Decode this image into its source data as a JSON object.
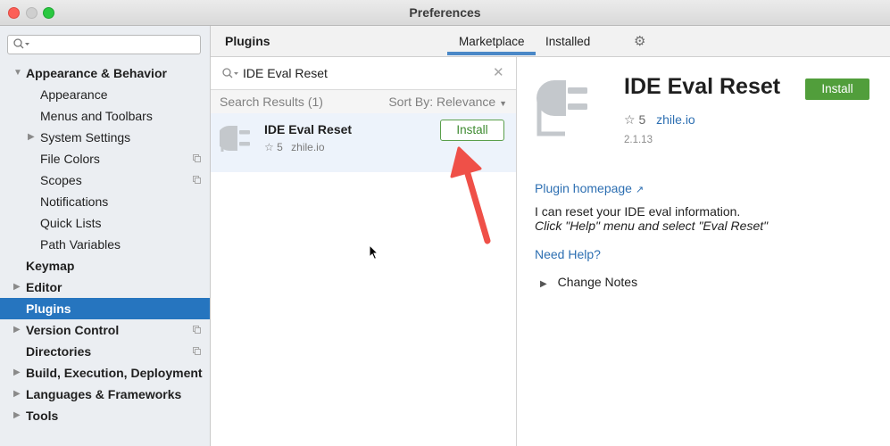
{
  "window": {
    "title": "Preferences"
  },
  "sidebar": {
    "search_placeholder": "",
    "items": [
      {
        "label": "Appearance & Behavior",
        "expanded": true,
        "bold": true
      },
      {
        "label": "Appearance"
      },
      {
        "label": "Menus and Toolbars"
      },
      {
        "label": "System Settings",
        "collapsed": true
      },
      {
        "label": "File Colors",
        "project": true
      },
      {
        "label": "Scopes",
        "project": true
      },
      {
        "label": "Notifications"
      },
      {
        "label": "Quick Lists"
      },
      {
        "label": "Path Variables"
      },
      {
        "label": "Keymap",
        "bold": true
      },
      {
        "label": "Editor",
        "bold": true
      },
      {
        "label": "Plugins",
        "bold": true,
        "selected": true
      },
      {
        "label": "Version Control",
        "bold": true,
        "project": true
      },
      {
        "label": "Directories",
        "bold": true,
        "project": true
      },
      {
        "label": "Build, Execution, Deployment",
        "bold": true
      },
      {
        "label": "Languages & Frameworks",
        "bold": true
      },
      {
        "label": "Tools",
        "bold": true
      }
    ]
  },
  "plugins": {
    "title": "Plugins",
    "tabs": [
      {
        "label": "Marketplace",
        "active": true
      },
      {
        "label": "Installed"
      }
    ],
    "search": {
      "value": "IDE Eval Reset"
    },
    "results_label": "Search Results (1)",
    "sort_label": "Sort By: Relevance",
    "results": [
      {
        "name": "IDE Eval Reset",
        "rating": "5",
        "vendor": "zhile.io",
        "install_label": "Install"
      }
    ]
  },
  "detail": {
    "name": "IDE Eval Reset",
    "install_label": "Install",
    "rating": "5",
    "vendor": "zhile.io",
    "version": "2.1.13",
    "homepage_label": "Plugin homepage",
    "desc_line1": "I can reset your IDE eval information.",
    "desc_line2": "Click \"Help\" menu and select \"Eval Reset\"",
    "need_help": "Need Help?",
    "change_notes": "Change Notes"
  },
  "colors": {
    "accent": "#2675bf",
    "install_green": "#519e3b",
    "link": "#2d6fb2",
    "annotation_arrow": "#ef5048"
  },
  "icons": [
    "search-icon",
    "gear-icon",
    "clear-icon",
    "plugin-plug-icon",
    "star-icon",
    "external-link-icon",
    "copy-icon",
    "pointer-cursor",
    "annotation-arrow"
  ]
}
